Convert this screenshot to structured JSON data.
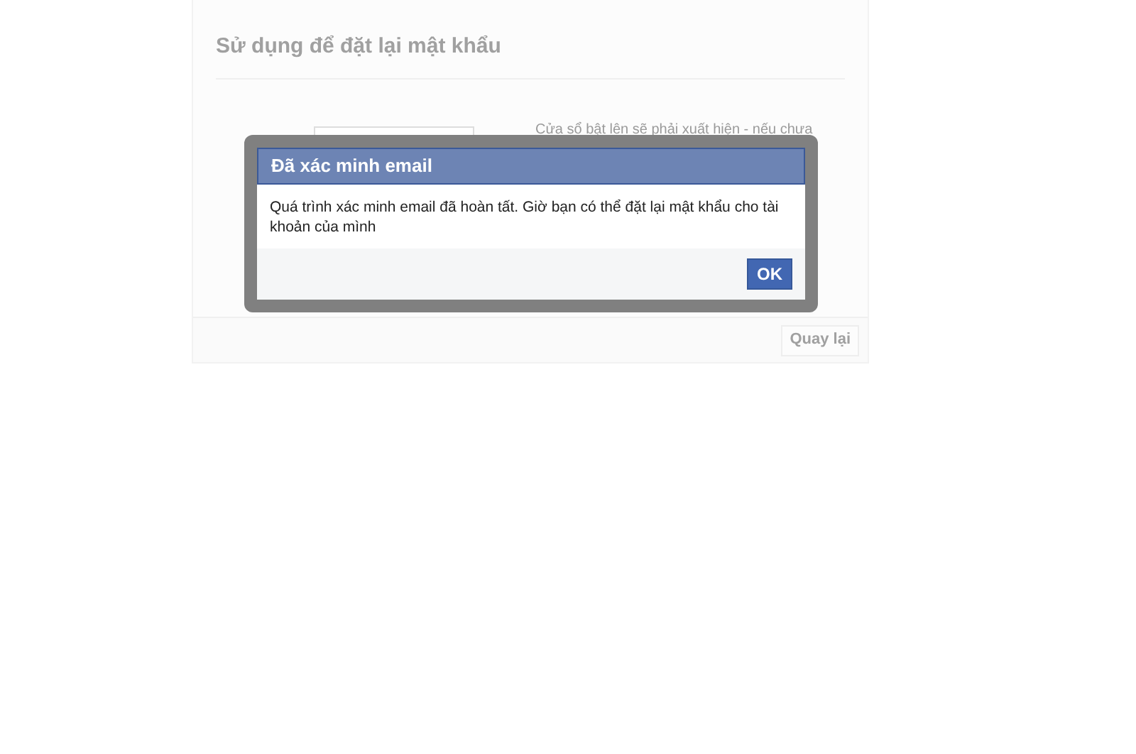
{
  "page": {
    "heading": "Sử dụng để đặt lại mật khẩu",
    "hint": "Cửa sổ bật lên sẽ phải xuất hiện - nếu chưa",
    "back_button": "Quay lại"
  },
  "dialog": {
    "title": "Đã xác minh email",
    "message": "Quá trình xác minh email đã hoàn tất. Giờ bạn có thể đặt lại mật khẩu cho tài khoản của mình",
    "buttons": [
      "OK"
    ]
  }
}
